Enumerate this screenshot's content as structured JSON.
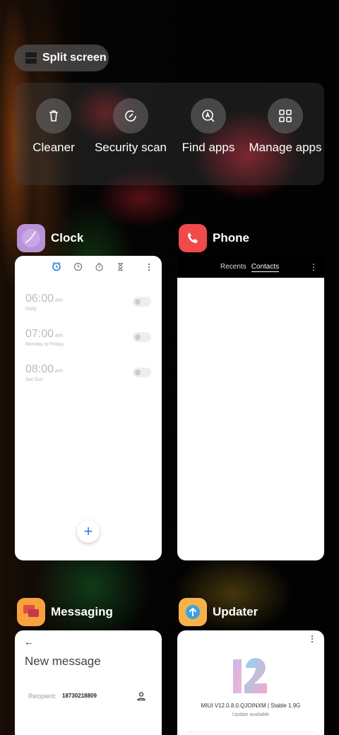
{
  "split_screen": {
    "label": "Split screen"
  },
  "quick_actions": [
    {
      "label": "Cleaner",
      "icon": "trash-icon"
    },
    {
      "label": "Security scan",
      "icon": "security-scan-icon"
    },
    {
      "label": "Find apps",
      "icon": "find-apps-icon"
    },
    {
      "label": "Manage apps",
      "icon": "manage-apps-icon"
    }
  ],
  "clock": {
    "name": "Clock",
    "alarms": [
      {
        "time": "06:00",
        "period": "am",
        "repeat": "Daily"
      },
      {
        "time": "07:00",
        "period": "am",
        "repeat": "Monday to Friday"
      },
      {
        "time": "08:00",
        "period": "am",
        "repeat": "Sat Sun"
      }
    ],
    "fab": "+"
  },
  "phone": {
    "name": "Phone",
    "tabs": [
      "Recents",
      "Contacts"
    ]
  },
  "messaging": {
    "name": "Messaging",
    "back": "←",
    "title": "New message",
    "recipient_label": "Recipient:",
    "recipient_number": "18730218809"
  },
  "updater": {
    "name": "Updater",
    "version": "MIUI V12.0.8.0.QJOINXM | Stable 1.9G",
    "status": "Update available"
  },
  "colors": {
    "accent_blue": "#2d7be5",
    "phone_icon": "#f04a4a",
    "messaging_icon": "#f7a23c",
    "updater_icon": "#f5b24a"
  }
}
